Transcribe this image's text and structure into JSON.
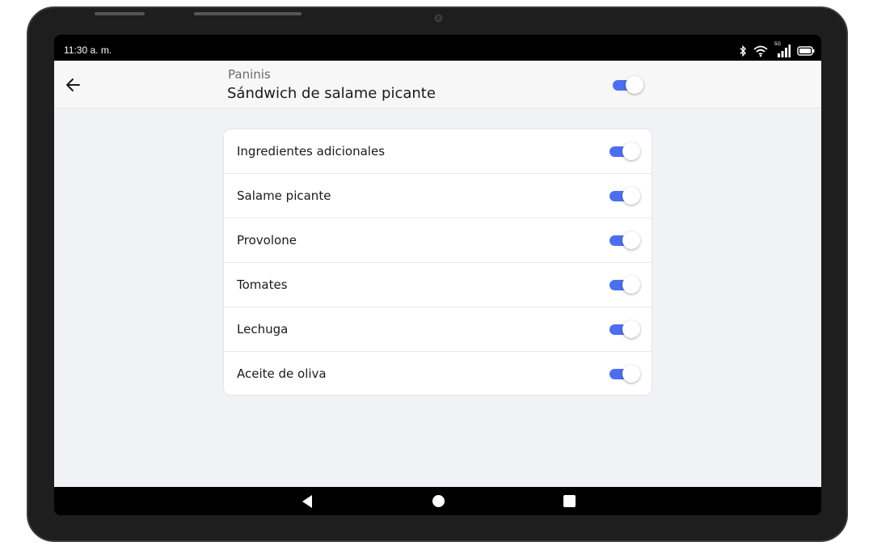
{
  "status_bar": {
    "time": "11:30 a. m.",
    "icons": [
      "bluetooth-icon",
      "wifi-icon",
      "cellular-signal-icon",
      "battery-icon"
    ],
    "signal_label": "5G"
  },
  "header": {
    "back_icon": "arrow-left-icon",
    "category": "Paninis",
    "title": "Sándwich de salame picante",
    "toggle_on": true
  },
  "ingredients": {
    "items": [
      {
        "label": "Ingredientes adicionales",
        "enabled": true
      },
      {
        "label": "Salame picante",
        "enabled": true
      },
      {
        "label": "Provolone",
        "enabled": true
      },
      {
        "label": "Tomates",
        "enabled": true
      },
      {
        "label": "Lechuga",
        "enabled": true
      },
      {
        "label": "Aceite de oliva",
        "enabled": true
      }
    ]
  },
  "nav_bar": {
    "buttons": [
      "back-triangle-icon",
      "home-circle-icon",
      "recents-square-icon"
    ]
  },
  "colors": {
    "accent": "#4c6ef0",
    "background": "#f0f2f5",
    "appbar": "#f7f7f7",
    "device_frame": "#1e1e1e"
  }
}
